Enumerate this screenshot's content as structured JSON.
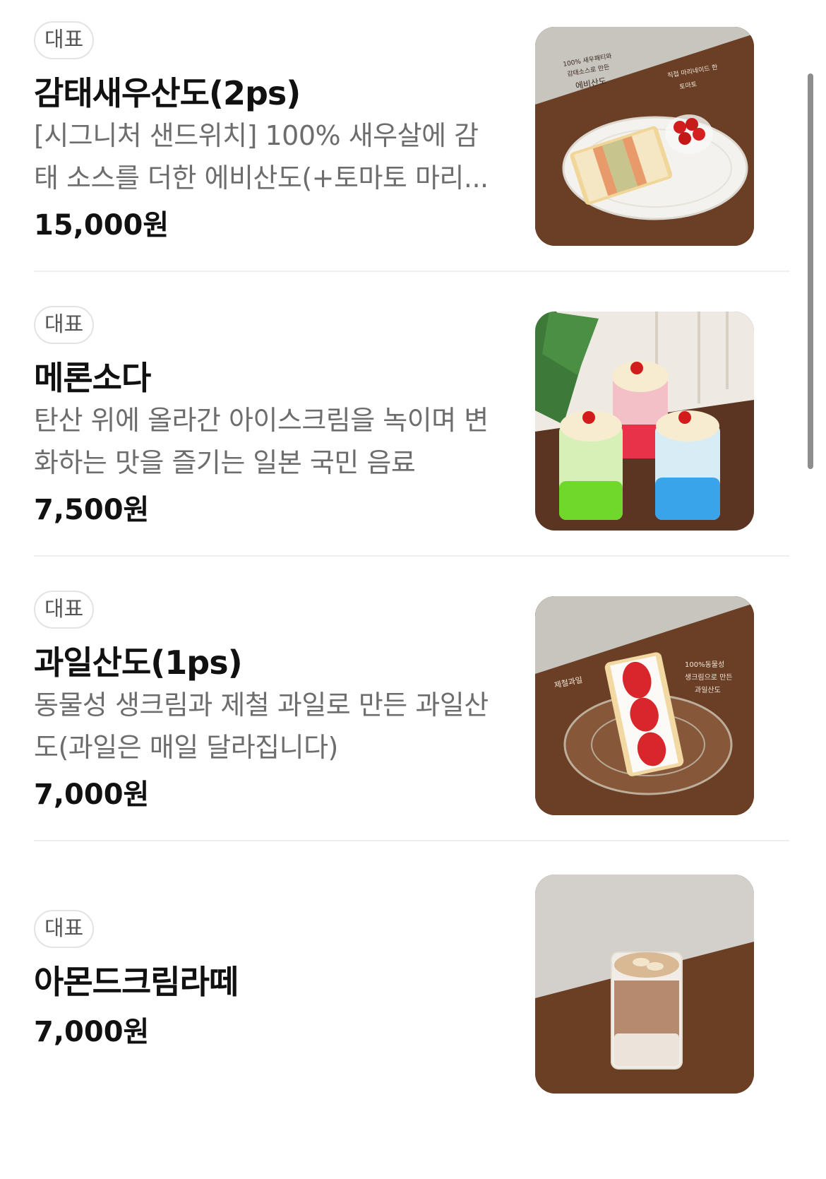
{
  "menu": {
    "items": [
      {
        "badge": "대표",
        "name": "감태새우산도(2ps)",
        "desc_lines": [
          "[시그니처 샌드위치] 100% 새우살에 감",
          "태 소스를 더한 에비산도(+토마토 마리..."
        ],
        "price": "15,000원",
        "photo": {
          "annotations": [
            "100% 새우패티와",
            "감태소스로 만든",
            "에비산도",
            "직접 마리네이드 한",
            "토마토"
          ]
        }
      },
      {
        "badge": "대표",
        "name": "메론소다",
        "desc_lines": [
          "탄산 위에 올라간 아이스크림을 녹이며 변",
          "화하는 맛을 즐기는 일본 국민 음료"
        ],
        "price": "7,500원"
      },
      {
        "badge": "대표",
        "name": "과일산도(1ps)",
        "desc_lines": [
          "동물성 생크림과 제철 과일로 만든 과일산",
          "도(과일은 매일 달라집니다)"
        ],
        "price": "7,000원",
        "photo": {
          "annotations": [
            "제철과일",
            "100%동물성",
            "생크림으로 만든",
            "과일산도"
          ]
        }
      },
      {
        "badge": "대표",
        "name": "아몬드크림라떼",
        "desc_lines": [],
        "price": "7,000원"
      }
    ]
  },
  "colors": {
    "badge_border": "#e3e3e3",
    "desc_text": "#6d6d6d",
    "divider": "#eeeeee",
    "table_wood": "#6b4026"
  }
}
